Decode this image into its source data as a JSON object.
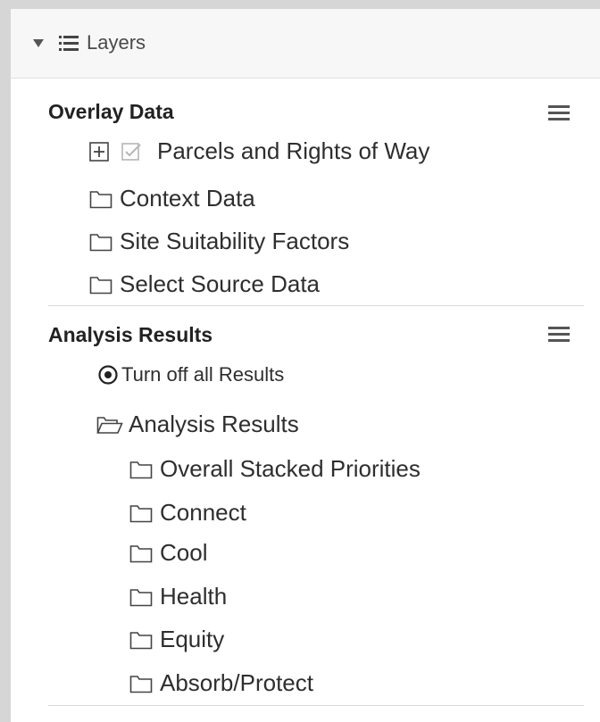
{
  "header": {
    "title": "Layers",
    "caret_icon": "caret-down-icon",
    "list_icon": "list-icon"
  },
  "overlay": {
    "title": "Overlay Data",
    "menu_icon": "hamburger-menu-icon",
    "items": [
      {
        "label": "Parcels and Rights of Way",
        "icon": "expand-plus-icon",
        "checked": true
      },
      {
        "label": "Context Data",
        "icon": "folder-icon"
      },
      {
        "label": "Site Suitability Factors",
        "icon": "folder-icon"
      },
      {
        "label": "Select Source Data",
        "icon": "folder-icon"
      }
    ]
  },
  "analysis": {
    "title": "Analysis Results",
    "menu_icon": "hamburger-menu-icon",
    "turn_off_label": "Turn off all Results",
    "folder_label": "Analysis Results",
    "subitems": [
      {
        "label": "Overall Stacked Priorities"
      },
      {
        "label": "Connect"
      },
      {
        "label": "Cool"
      },
      {
        "label": "Health"
      },
      {
        "label": "Equity"
      },
      {
        "label": "Absorb/Protect"
      }
    ]
  }
}
